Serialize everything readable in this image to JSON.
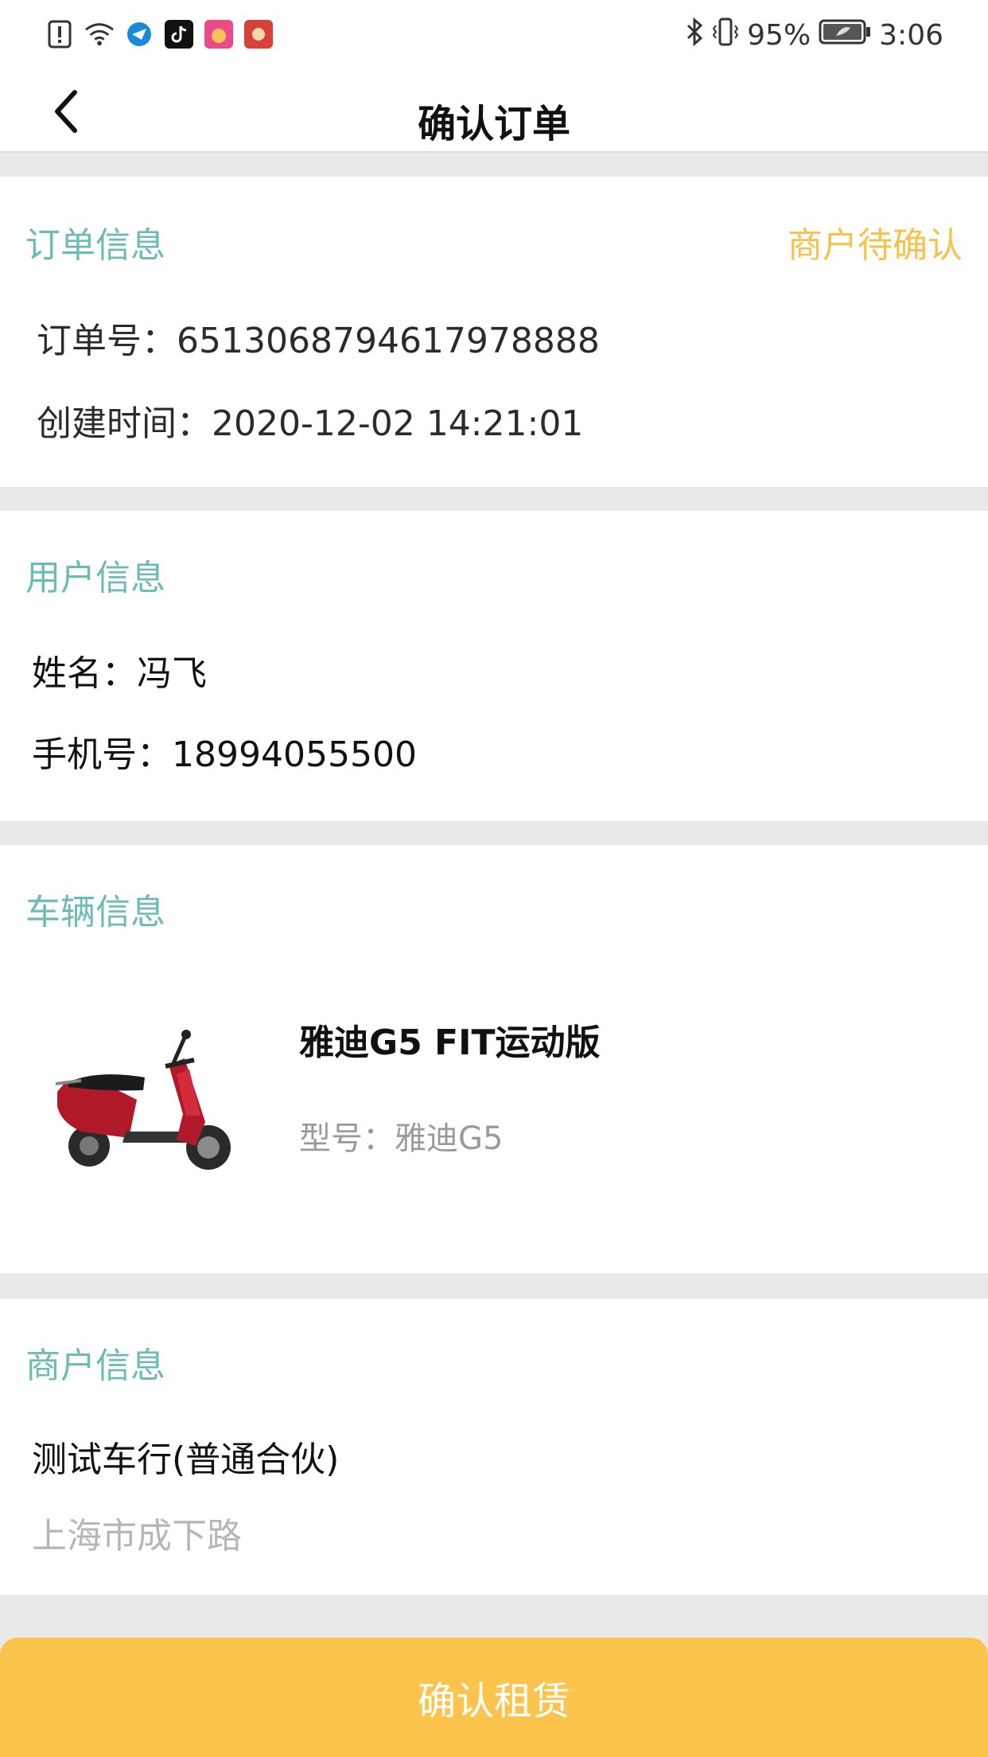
{
  "status_bar": {
    "battery": "95%",
    "time": "3:06",
    "icons": [
      "alert-icon",
      "wifi-icon",
      "browser-icon",
      "tiktok-icon",
      "app-icon",
      "app-icon-2",
      "bluetooth-icon",
      "vibrate-icon",
      "battery-icon"
    ]
  },
  "header": {
    "title": "确认订单",
    "back_icon": "chevron-left-icon"
  },
  "order": {
    "section_title": "订单信息",
    "status": "商户待确认",
    "order_no_label": "订单号：",
    "order_no": "6513068794617978888",
    "created_label": "创建时间：",
    "created_at": "2020-12-02 14:21:01"
  },
  "user": {
    "section_title": "用户信息",
    "name_label": "姓名：",
    "name": "冯飞",
    "phone_label": "手机号：",
    "phone": "18994055500"
  },
  "vehicle": {
    "section_title": "车辆信息",
    "name": "雅迪G5 FIT运动版",
    "model_label": "型号：",
    "model": "雅迪G5",
    "image_icon": "scooter-image"
  },
  "merchant": {
    "section_title": "商户信息",
    "name": "测试车行(普通合伙)",
    "address": "上海市成下路"
  },
  "actions": {
    "confirm_label": "确认租赁"
  },
  "colors": {
    "section_title": "#6cbcb4",
    "status": "#f6c24a",
    "button": "#fcc34d"
  }
}
